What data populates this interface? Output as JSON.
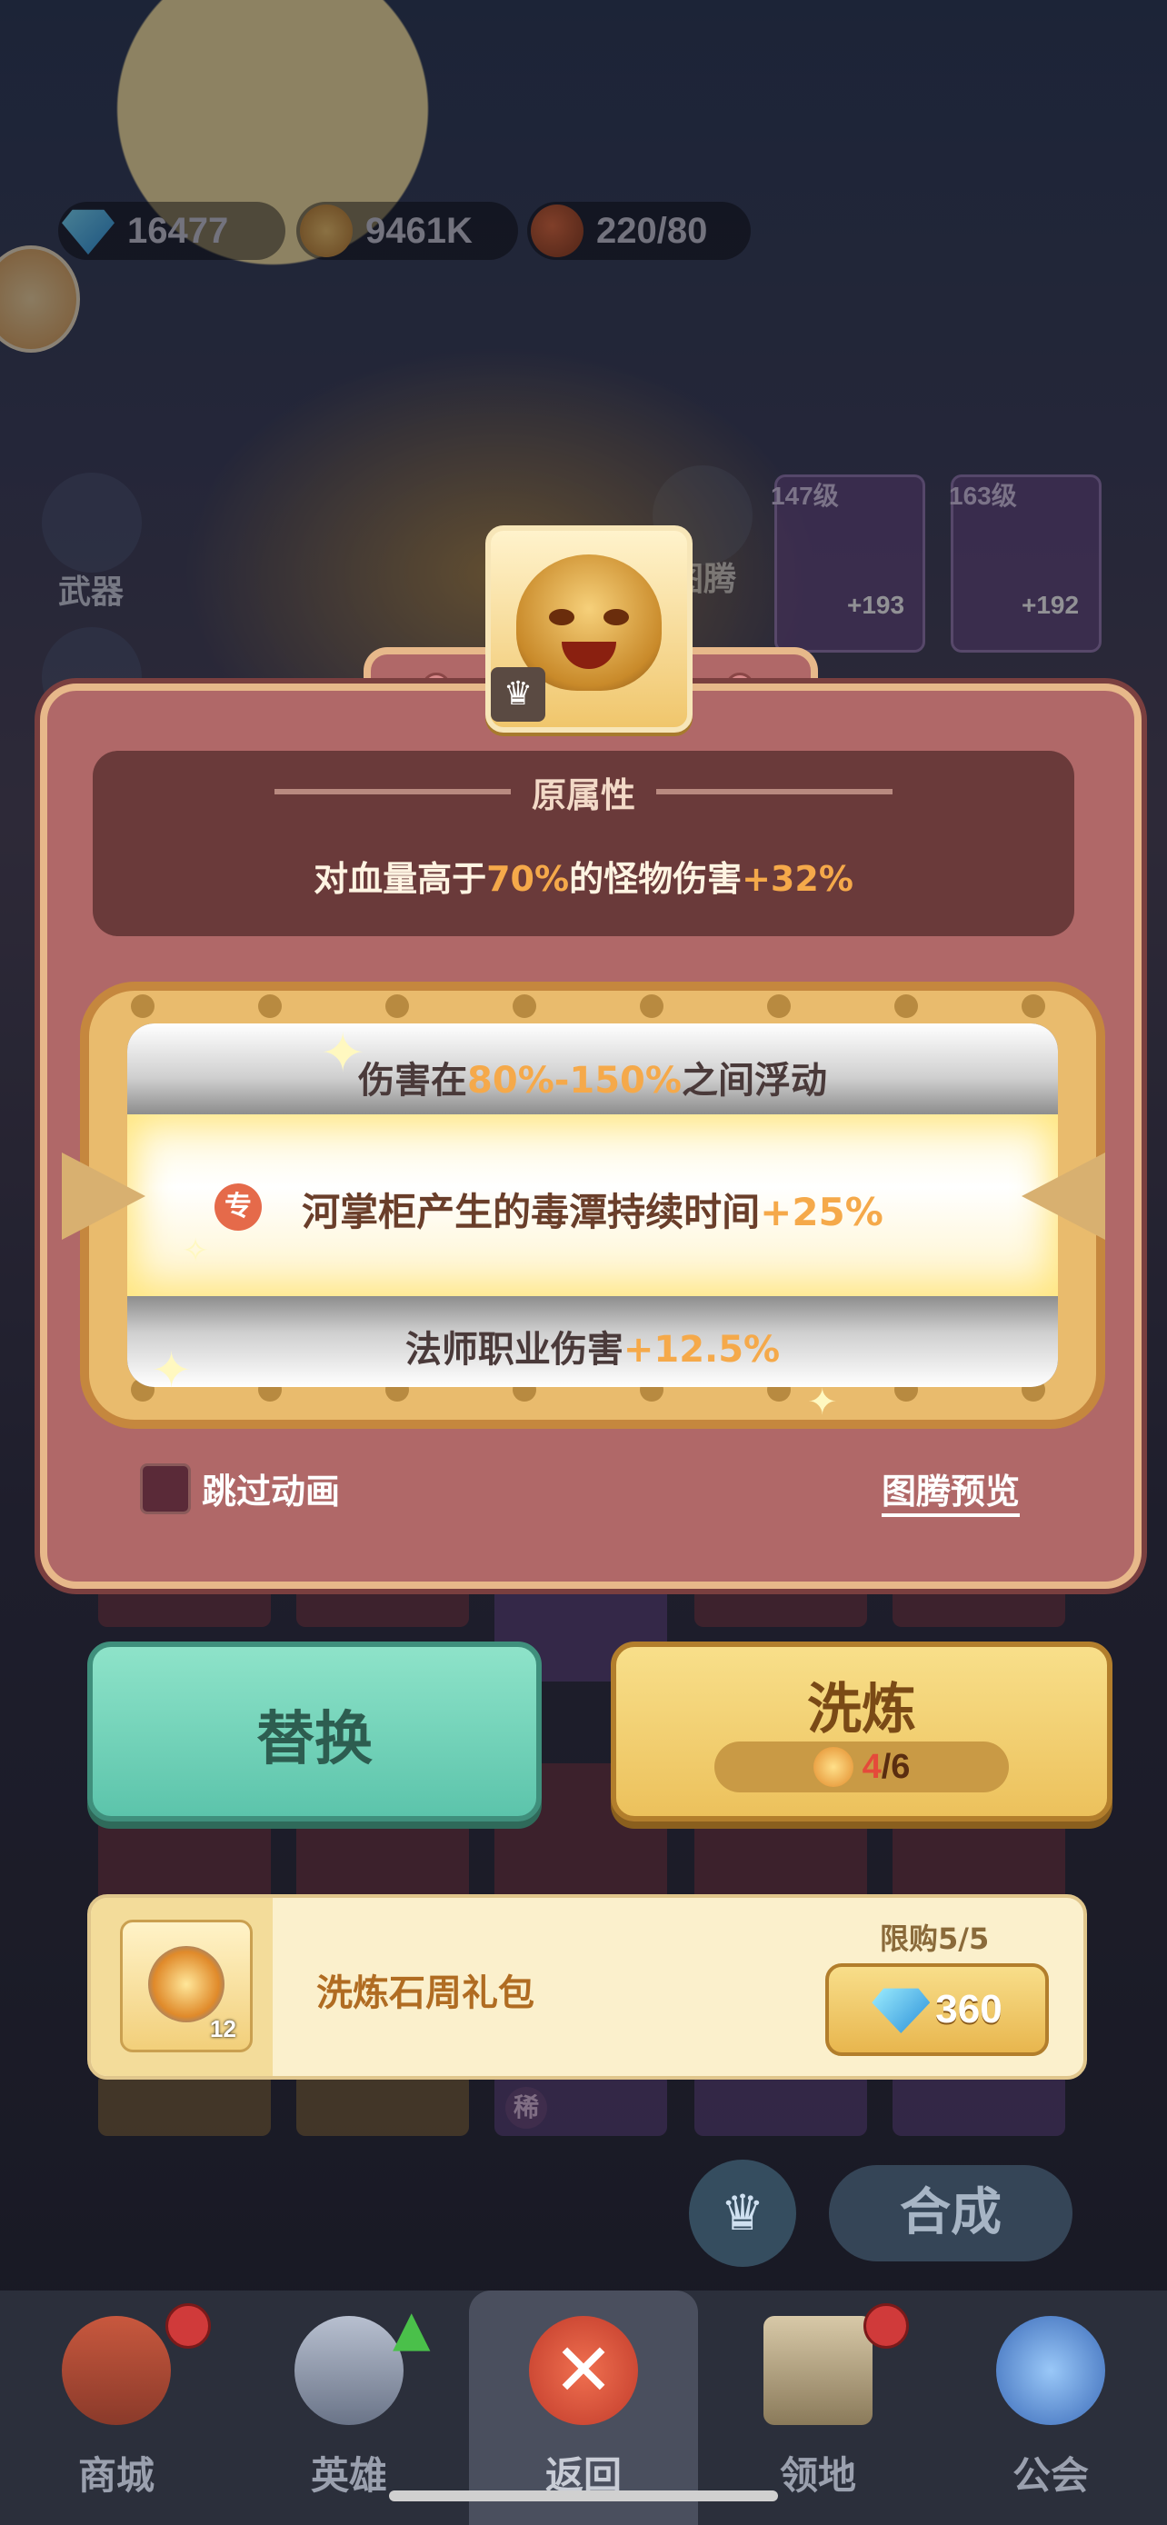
{
  "currency": {
    "diamonds": "16477",
    "coins": "9461K",
    "stamina": "220/80"
  },
  "side_menu": {
    "weapon_label": "武器",
    "totem_label": "图腾"
  },
  "heroes": [
    {
      "level": "147级",
      "bonus": "+193"
    },
    {
      "level": "163级",
      "bonus": "+192"
    }
  ],
  "panel": {
    "original_title": "原属性",
    "original_value_prefix": "对血量高于",
    "original_value_hl1": "70%",
    "original_value_mid": "的怪物伤害",
    "original_value_hl2": "+32%",
    "slot_top_prefix": "伤害在",
    "slot_top_hl": "80%-150%",
    "slot_top_suffix": "之间浮动",
    "slot_mid_badge": "专",
    "slot_mid_prefix": "河掌柜产生的毒潭持续时间",
    "slot_mid_hl": "+25%",
    "slot_bot_prefix": "法师职业伤害",
    "slot_bot_hl": "+12.5%",
    "skip_label": "跳过动画",
    "preview_label": "图腾预览"
  },
  "actions": {
    "replace_label": "替换",
    "reroll_label": "洗炼",
    "reroll_used": "4",
    "reroll_total": "/6"
  },
  "gift": {
    "qty": "12",
    "name": "洗炼石周礼包",
    "limit": "限购5/5",
    "price": "360"
  },
  "bottom": {
    "rare_badge": "稀",
    "compose_label": "合成"
  },
  "nav": [
    {
      "label": "商城"
    },
    {
      "label": "英雄"
    },
    {
      "label": "返回"
    },
    {
      "label": "领地"
    },
    {
      "label": "公会"
    }
  ],
  "colors": {
    "highlight": "#f5a94a",
    "panel": "#b06868",
    "replace_button": "#5cc4ab",
    "reroll_button": "#ecc15c"
  }
}
